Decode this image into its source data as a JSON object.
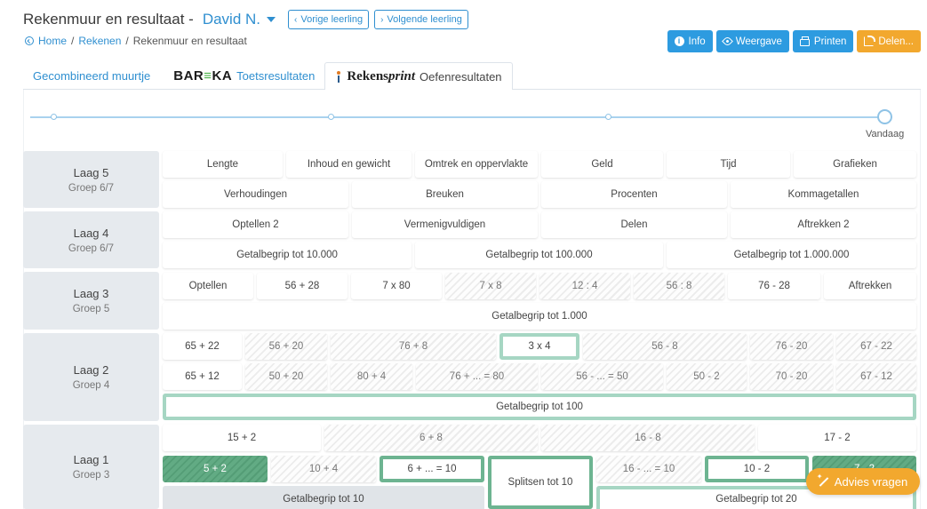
{
  "header": {
    "title": "Rekenmuur en resultaat -",
    "student": "David N.",
    "prev_label": "Vorige leerling",
    "next_label": "Volgende leerling"
  },
  "breadcrumb": {
    "home": "Home",
    "sep1": "/",
    "rekenen": "Rekenen",
    "sep2": "/",
    "current": "Rekenmuur en resultaat"
  },
  "actions": {
    "info": "Info",
    "weergave": "Weergave",
    "printen": "Printen",
    "delen": "Delen..."
  },
  "tabs": {
    "gecombineerd": "Gecombineerd muurtje",
    "bareka_a": "BAR",
    "bareka_eq": "≡",
    "bareka_b": "KA",
    "toets": "Toetsresultaten",
    "rekens_a": "Rekens",
    "rekens_b": "print",
    "oefen": "Oefenresultaten"
  },
  "timeline": {
    "today": "Vandaag"
  },
  "layers": {
    "l5": {
      "name": "Laag 5",
      "group": "Groep 6/7"
    },
    "l4": {
      "name": "Laag 4",
      "group": "Groep 6/7"
    },
    "l3": {
      "name": "Laag 3",
      "group": "Groep 5"
    },
    "l2": {
      "name": "Laag 2",
      "group": "Groep 4"
    },
    "l1": {
      "name": "Laag 1",
      "group": "Groep 3"
    }
  },
  "cells": {
    "c5a": [
      "Lengte",
      "Inhoud en gewicht",
      "Omtrek en oppervlakte",
      "Geld",
      "Tijd",
      "Grafieken"
    ],
    "c5b": [
      "Verhoudingen",
      "Breuken",
      "Procenten",
      "Kommagetallen"
    ],
    "c4a": [
      "Optellen 2",
      "Vermenigvuldigen",
      "Delen",
      "Aftrekken 2"
    ],
    "c4b": [
      "Getalbegrip tot 10.000",
      "Getalbegrip tot 100.000",
      "Getalbegrip tot 1.000.000"
    ],
    "c3a": [
      "Optellen",
      "56 + 28",
      "7 x 80",
      "7 x 8",
      "12 : 4",
      "56 : 8",
      "76 - 28",
      "Aftrekken"
    ],
    "c3b": [
      "Getalbegrip tot 1.000"
    ],
    "c2a": [
      "65 + 22",
      "56 + 20",
      "76 + 8",
      "3 x 4",
      "56 - 8",
      "76 - 20",
      "67 - 22"
    ],
    "c2b": [
      "65 + 12",
      "50 + 20",
      "80 + 4",
      "76 + ... = 80",
      "56 - ... = 50",
      "50 - 2",
      "70 - 20",
      "67 - 12"
    ],
    "c2c": [
      "Getalbegrip tot 100"
    ],
    "c1a": [
      "15 + 2",
      "6 + 8",
      "16 - 8",
      "17 - 2"
    ],
    "c1b": [
      "5 + 2",
      "10 + 4",
      "6 + ... = 10",
      "Splitsen tot 10",
      "16 - ... = 10",
      "10 - 2",
      "7 - 2"
    ],
    "c1c": [
      "Getalbegrip tot 10",
      "Getalbegrip tot 20"
    ]
  },
  "advies": "Advies vragen"
}
